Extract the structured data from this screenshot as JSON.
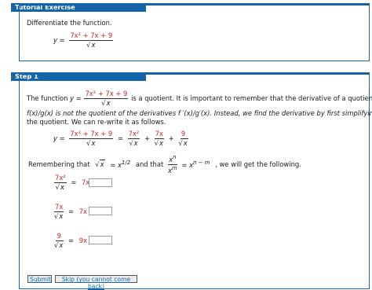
{
  "tutorial": {
    "header": "Tutorial Exercise",
    "instruction": "Differentiate the function."
  },
  "problem": {
    "lhs": "y =",
    "numerator": "7x² + 7x + 9",
    "denominator_var": "x"
  },
  "step": {
    "header": "Step 1",
    "line1_before": "The function",
    "line1_y": "y =",
    "line1_after": "is a quotient. It is important to remember that the derivative of a quotient",
    "line2": "f(x)/g(x)  is not the quotient of the derivatives  f ′(x)/g′(x).  Instead, we find the derivative by first simplifying",
    "line3": "the quotient. We can re-write it as follows.",
    "rewrite": {
      "lhs": "y =",
      "term1_num": "7x²",
      "term2_num": "7x",
      "term3_num": "9",
      "eq": "=",
      "plus": "+"
    },
    "remember": {
      "before": "Remembering that",
      "sqrt_rhs": "= x",
      "sqrt_exp": "1/2",
      "and_that": "and that",
      "frac_num_base": "x",
      "frac_num_exp": "n",
      "frac_den_base": "x",
      "frac_den_exp": "m",
      "rhs": "= x",
      "rhs_exp": "n − m",
      "after": ",  we will get the following."
    },
    "parts": [
      {
        "num": "7x²",
        "prefix": "7x",
        "answer": ""
      },
      {
        "num": "7x",
        "prefix": "7x",
        "answer": ""
      },
      {
        "num": "9",
        "prefix": "9x",
        "answer": ""
      }
    ]
  },
  "buttons": {
    "submit": "Submit",
    "skip": "Skip (you cannot come back)"
  }
}
